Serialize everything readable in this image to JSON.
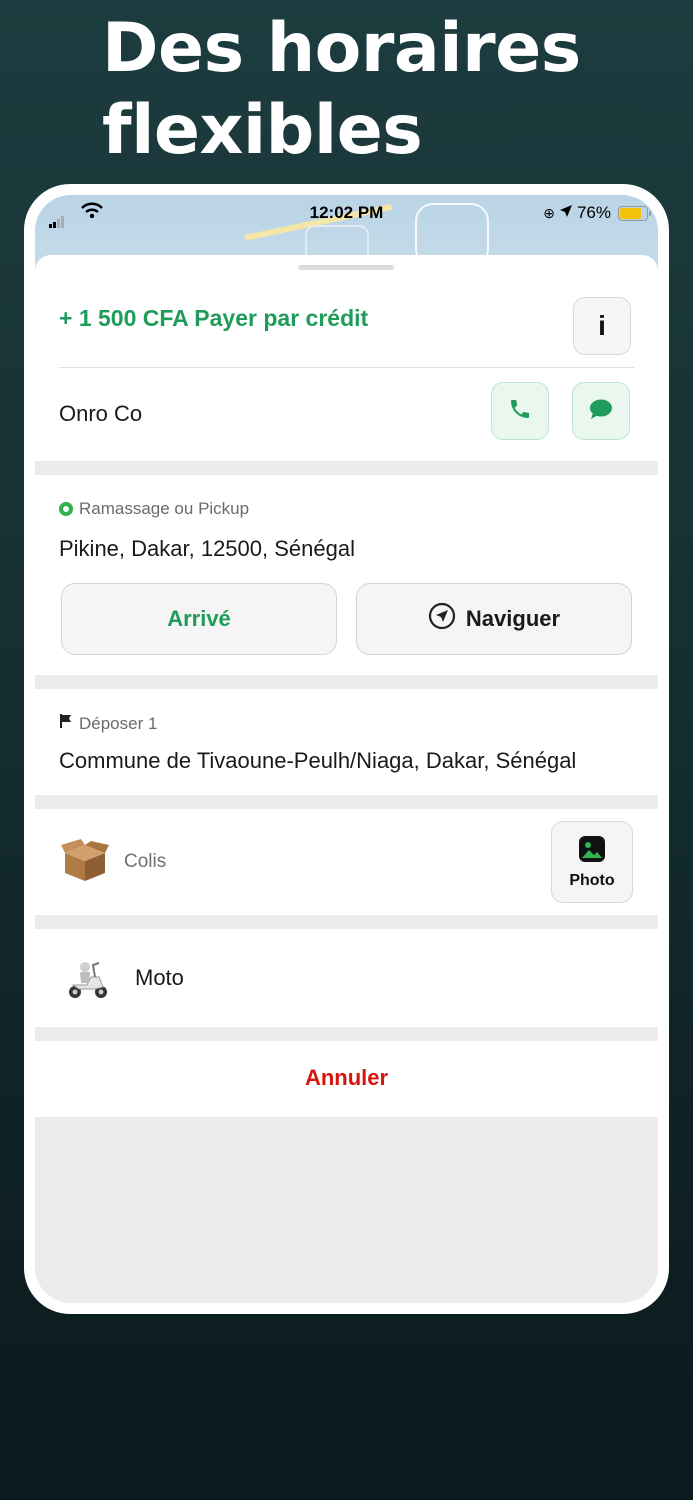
{
  "headline": "Des horaires flexibles",
  "status_bar": {
    "time": "12:02 PM",
    "battery": "76%",
    "battery_level": 0.76
  },
  "order": {
    "payment": "+ 1 500 CFA Payer par crédit",
    "info_label": "i",
    "customer": "Onro Co"
  },
  "pickup": {
    "label": "Ramassage ou Pickup",
    "address": "Pikine, Dakar, 12500, Sénégal",
    "arrive_label": "Arrivé",
    "navigate_label": "Naviguer"
  },
  "dropoff": {
    "label": "Déposer 1",
    "address": "Commune de Tivaoune-Peulh/Niaga, Dakar, Sénégal"
  },
  "package": {
    "label": "Colis",
    "photo_label": "Photo"
  },
  "vehicle": {
    "label": "Moto"
  },
  "cancel_label": "Annuler",
  "colors": {
    "accent_green": "#1f9c5a",
    "cancel_red": "#d7150f",
    "background": "#163032"
  },
  "icons": [
    "signal-icon",
    "wifi-icon",
    "location-arrow-icon",
    "phone-icon",
    "chat-icon",
    "navigation-icon",
    "flag-icon",
    "box-icon",
    "photo-icon",
    "scooter-icon"
  ]
}
